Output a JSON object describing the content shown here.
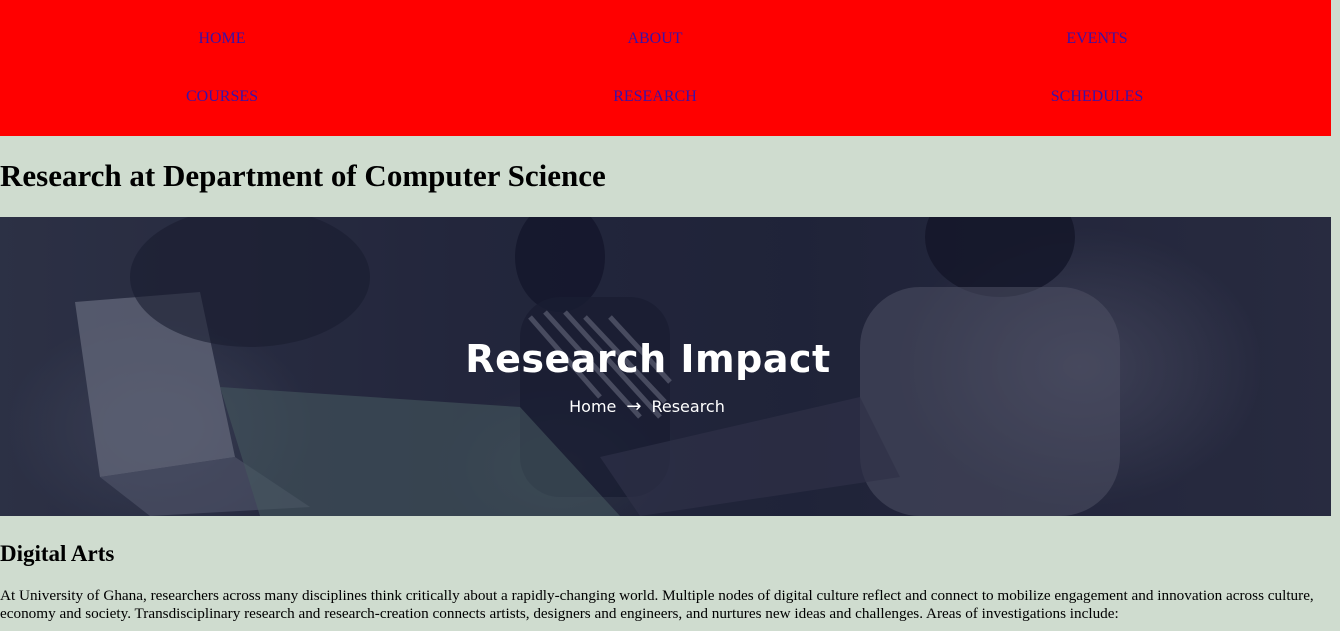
{
  "nav": {
    "items": [
      {
        "label": "HOME"
      },
      {
        "label": "ABOUT"
      },
      {
        "label": "EVENTS"
      },
      {
        "label": "COURSES"
      },
      {
        "label": "RESEARCH"
      },
      {
        "label": "SCHEDULES"
      }
    ],
    "background_color": "#ff0000",
    "link_color": "#3a12a8"
  },
  "page_title": "Research at Department of Computer Science",
  "hero": {
    "title": "Research Impact",
    "breadcrumb_home": "Home",
    "breadcrumb_arrow_icon": "arrow-right-icon",
    "breadcrumb_current": "Research"
  },
  "section": {
    "heading": "Digital Arts",
    "body": "At University of Ghana, researchers across many disciplines think critically about a rapidly-changing world. Multiple nodes of digital culture reflect and connect to mobilize engagement and innovation across culture, economy and society. Transdisciplinary research and research-creation connects artists, designers and engineers, and nurtures new ideas and challenges. Areas of investigations include:"
  },
  "colors": {
    "page_background": "#cfdccf"
  }
}
